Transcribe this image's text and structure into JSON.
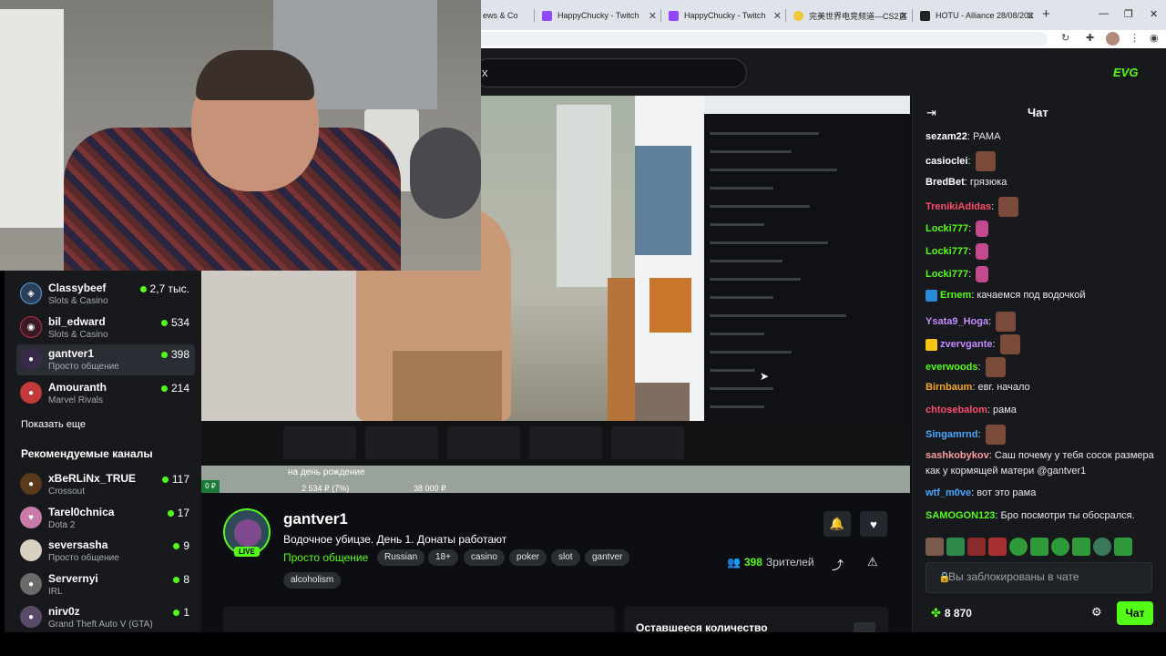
{
  "browser": {
    "tabs": [
      {
        "label": "ews & Co"
      },
      {
        "label": "HappyChucky - Twitch"
      },
      {
        "label": "HappyChucky - Twitch"
      },
      {
        "label": "完美世界电竞频道—CS2直"
      },
      {
        "label": "HOTU - Alliance 28/08/202"
      }
    ],
    "newtab": "+"
  },
  "header": {
    "search_partial": "x",
    "logo": "EVG"
  },
  "video": {
    "caption": "на день рождение",
    "stat_amount": "2 534 ₽ (7%)",
    "stat_goal": "38 000 ₽",
    "progress_label": "0 ₽"
  },
  "sidebar": {
    "followed": [
      {
        "name": "Classybeef",
        "category": "Slots & Casino",
        "viewers": "2,7 тыс."
      },
      {
        "name": "bil_edward",
        "category": "Slots & Casino",
        "viewers": "534"
      },
      {
        "name": "gantver1",
        "category": "Просто общение",
        "viewers": "398"
      },
      {
        "name": "Amouranth",
        "category": "Marvel Rivals",
        "viewers": "214"
      }
    ],
    "show_more": "Показать еще",
    "recommended_heading": "Рекомендуемые каналы",
    "recommended": [
      {
        "name": "xBeRLiNx_TRUE",
        "category": "Crossout",
        "viewers": "117"
      },
      {
        "name": "Tarel0chnica",
        "category": "Dota 2",
        "viewers": "17"
      },
      {
        "name": "seversasha",
        "category": "Просто общение",
        "viewers": "9"
      },
      {
        "name": "Servernyi",
        "category": "IRL",
        "viewers": "8"
      },
      {
        "name": "nirv0z",
        "category": "Grand Theft Auto V (GTA)",
        "viewers": "1"
      }
    ]
  },
  "stream": {
    "live_label": "LIVE",
    "channel": "gantver1",
    "title": "Водочное убицзе. День 1. Донаты работают",
    "category": "Просто общение",
    "tags": [
      "Russian",
      "18+",
      "casino",
      "poker",
      "slot",
      "gantver",
      "alcoholism"
    ],
    "viewers_count": "398",
    "viewers_label": "Зрителей",
    "remaining_title": "Оставшееся количество"
  },
  "chat": {
    "title": "Чат",
    "messages": [
      {
        "user": "sezam22",
        "color": "#ffffff",
        "text": " РАМА",
        "emote": ""
      },
      {
        "user": "casioclei",
        "color": "#ffffff",
        "text": "",
        "emote": "face"
      },
      {
        "user": "BredBet",
        "color": "#ffffff",
        "text": " грязюка",
        "emote": ""
      },
      {
        "user": "TrenikiAdidas",
        "color": "#ff4c6d",
        "text": "",
        "emote": "face"
      },
      {
        "user": "Locki777",
        "color": "#53fc18",
        "text": "",
        "emote": "heart"
      },
      {
        "user": "Locki777",
        "color": "#53fc18",
        "text": "",
        "emote": "heart"
      },
      {
        "user": "Locki777",
        "color": "#53fc18",
        "text": "",
        "emote": "heart"
      },
      {
        "user": "Ernem",
        "color": "#53fc18",
        "text": " качаемся под водочкой",
        "emote": ""
      },
      {
        "user": "Ysata9_Hoga",
        "color": "#c38bff",
        "text": "",
        "emote": "face"
      },
      {
        "user": "zvervgante",
        "color": "#c38bff",
        "text": "",
        "emote": "face"
      },
      {
        "user": "everwoods",
        "color": "#53fc18",
        "text": "",
        "emote": "face"
      },
      {
        "user": "Birnbaum",
        "color": "#f5a623",
        "text": " евг. начало",
        "emote": ""
      },
      {
        "user": "chtosebalom",
        "color": "#ff4c6d",
        "text": " рама",
        "emote": ""
      },
      {
        "user": "Singamrnd",
        "color": "#4aa8ff",
        "text": "",
        "emote": "face"
      },
      {
        "user": "sashkobykov",
        "color": "#ff9c9c",
        "text": " Саш почему у тебя сосок размера как у кормящей матери @gantver1",
        "emote": ""
      },
      {
        "user": "wtf_m0ve",
        "color": "#4aa8ff",
        "text": " вот это рама",
        "emote": ""
      },
      {
        "user": "SAMOGON123",
        "color": "#53fc18",
        "text": " Бро посмотри ты обосрался.",
        "emote": ""
      }
    ],
    "input_placeholder": "Вы заблокированы в чате",
    "points": "8 870",
    "send_label": "Чат"
  },
  "colors": {
    "brand": "#53fc18",
    "bg": "#0d0e12",
    "panel": "#17191d"
  }
}
